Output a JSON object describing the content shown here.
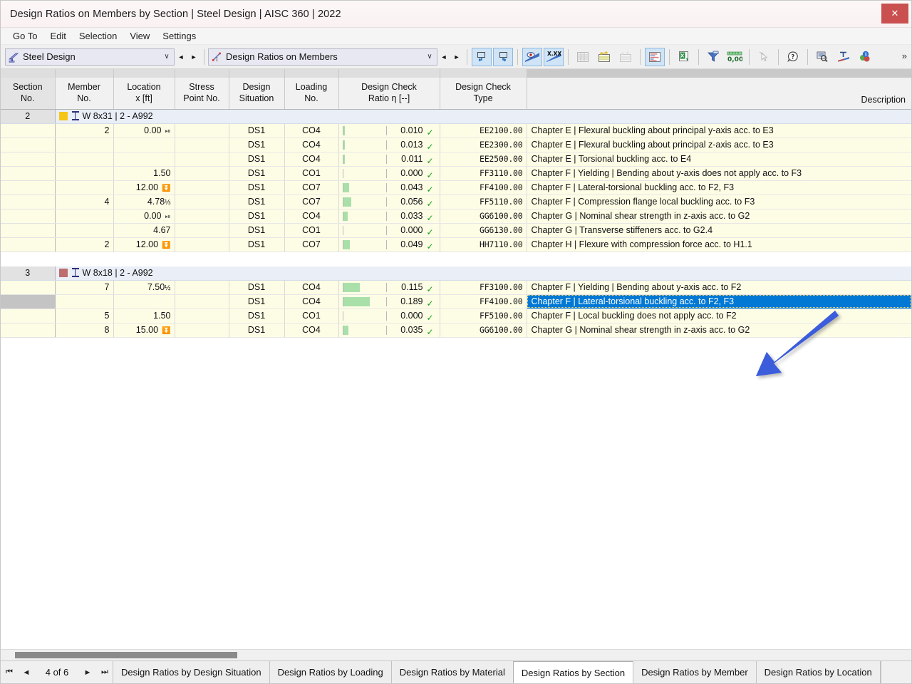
{
  "window": {
    "title": "Design Ratios on Members by Section | Steel Design | AISC 360 | 2022",
    "close_label": "✕"
  },
  "menubar": {
    "items": [
      {
        "label": "Go To"
      },
      {
        "label": "Edit"
      },
      {
        "label": "Selection"
      },
      {
        "label": "View"
      },
      {
        "label": "Settings"
      }
    ]
  },
  "toolbar": {
    "combo_module": {
      "value": "Steel Design",
      "chevron": "∨"
    },
    "combo_table": {
      "value": "Design Ratios on Members",
      "chevron": "∨"
    },
    "nav_prev": "◄",
    "nav_next": "►",
    "overflow": "»",
    "buttons": [
      {
        "name": "select-in-graphic-icon",
        "active": true
      },
      {
        "name": "select-in-table-icon",
        "active": true
      },
      {
        "name": "show-results-icon",
        "active": true
      },
      {
        "name": "show-values-icon",
        "active": true
      },
      {
        "name": "table-grid-icon",
        "active": false
      },
      {
        "name": "table-highlight-icon",
        "active": false
      },
      {
        "name": "table-plain-icon",
        "active": false
      },
      {
        "name": "result-diagram-icon",
        "active": true
      },
      {
        "name": "export-excel-icon",
        "active": false
      },
      {
        "name": "filter-icon",
        "active": false
      },
      {
        "name": "decimal-places-icon",
        "active": false
      },
      {
        "name": "pointer-disabled-icon",
        "active": false
      },
      {
        "name": "help-icon",
        "active": false
      },
      {
        "name": "find-icon",
        "active": false
      },
      {
        "name": "units-icon",
        "active": false
      },
      {
        "name": "info-colors-icon",
        "active": false
      }
    ]
  },
  "table": {
    "columns": [
      {
        "key": "rowhdr",
        "label": ""
      },
      {
        "key": "section_no",
        "label_l1": "Section",
        "label_l2": "No."
      },
      {
        "key": "member_no",
        "label_l1": "Member",
        "label_l2": "No."
      },
      {
        "key": "location",
        "label_l1": "Location",
        "label_l2": "x [ft]"
      },
      {
        "key": "stress_point",
        "label_l1": "Stress",
        "label_l2": "Point No."
      },
      {
        "key": "design_situation",
        "label_l1": "Design",
        "label_l2": "Situation"
      },
      {
        "key": "loading_no",
        "label_l1": "Loading",
        "label_l2": "No."
      },
      {
        "key": "ratio",
        "label_l1": "Design Check",
        "label_l2": "Ratio η [--]"
      },
      {
        "key": "check_type",
        "label_l1": "Design Check",
        "label_l2": "Type"
      },
      {
        "key": "description",
        "label_l1": "",
        "label_l2": "Description"
      }
    ],
    "groups": [
      {
        "section_no": "2",
        "swatch_color": "#f5c518",
        "label": "W 8x31 | 2 - A992",
        "rows": [
          {
            "member_no": "2",
            "location": "0.00",
            "locmark": "start",
            "stress_point": "",
            "design_situation": "DS1",
            "loading_no": "CO4",
            "ratio": "0.010",
            "ratio_value": 0.01,
            "check_type": "EE2100.00",
            "description": "Chapter E | Flexural buckling about principal y-axis acc. to E3",
            "selected": false
          },
          {
            "member_no": "",
            "location": "",
            "locmark": "",
            "stress_point": "",
            "design_situation": "DS1",
            "loading_no": "CO4",
            "ratio": "0.013",
            "ratio_value": 0.013,
            "check_type": "EE2300.00",
            "description": "Chapter E | Flexural buckling about principal z-axis acc. to E3",
            "selected": false
          },
          {
            "member_no": "",
            "location": "",
            "locmark": "",
            "stress_point": "",
            "design_situation": "DS1",
            "loading_no": "CO4",
            "ratio": "0.011",
            "ratio_value": 0.011,
            "check_type": "EE2500.00",
            "description": "Chapter E | Torsional buckling acc. to E4",
            "selected": false
          },
          {
            "member_no": "",
            "location": "1.50",
            "locmark": "",
            "stress_point": "",
            "design_situation": "DS1",
            "loading_no": "CO1",
            "ratio": "0.000",
            "ratio_value": 0.0,
            "check_type": "FF3110.00",
            "description": "Chapter F | Yielding | Bending about y-axis does not apply acc. to F3",
            "selected": false
          },
          {
            "member_no": "",
            "location": "12.00",
            "locmark": "end",
            "stress_point": "",
            "design_situation": "DS1",
            "loading_no": "CO7",
            "ratio": "0.043",
            "ratio_value": 0.043,
            "check_type": "FF4100.00",
            "description": "Chapter F | Lateral-torsional buckling acc. to F2, F3",
            "selected": false
          },
          {
            "member_no": "4",
            "location": "4.78",
            "locfrac": "1/3",
            "locmark": "",
            "stress_point": "",
            "design_situation": "DS1",
            "loading_no": "CO7",
            "ratio": "0.056",
            "ratio_value": 0.056,
            "check_type": "FF5110.00",
            "description": "Chapter F | Compression flange local buckling acc. to F3",
            "selected": false
          },
          {
            "member_no": "",
            "location": "0.00",
            "locmark": "start",
            "stress_point": "",
            "design_situation": "DS1",
            "loading_no": "CO4",
            "ratio": "0.033",
            "ratio_value": 0.033,
            "check_type": "GG6100.00",
            "description": "Chapter G | Nominal shear strength in z-axis acc. to G2",
            "selected": false
          },
          {
            "member_no": "",
            "location": "4.67",
            "locmark": "",
            "stress_point": "",
            "design_situation": "DS1",
            "loading_no": "CO1",
            "ratio": "0.000",
            "ratio_value": 0.0,
            "check_type": "GG6130.00",
            "description": "Chapter G | Transverse stiffeners acc. to G2.4",
            "selected": false
          },
          {
            "member_no": "2",
            "location": "12.00",
            "locmark": "end",
            "stress_point": "",
            "design_situation": "DS1",
            "loading_no": "CO7",
            "ratio": "0.049",
            "ratio_value": 0.049,
            "check_type": "HH7110.00",
            "description": "Chapter H | Flexure with compression force acc. to H1.1",
            "selected": false
          }
        ]
      },
      {
        "section_no": "3",
        "swatch_color": "#bd6d6d",
        "label": "W 8x18 | 2 - A992",
        "rows": [
          {
            "member_no": "7",
            "location": "7.50",
            "locfrac": "1/2",
            "locmark": "",
            "stress_point": "",
            "design_situation": "DS1",
            "loading_no": "CO4",
            "ratio": "0.115",
            "ratio_value": 0.115,
            "check_type": "FF3100.00",
            "description": "Chapter F | Yielding | Bending about y-axis acc. to F2",
            "selected": false
          },
          {
            "member_no": "",
            "location": "",
            "locmark": "",
            "stress_point": "",
            "design_situation": "DS1",
            "loading_no": "CO4",
            "ratio": "0.189",
            "ratio_value": 0.189,
            "check_type": "FF4100.00",
            "description": "Chapter F | Lateral-torsional buckling acc. to F2, F3",
            "selected": true
          },
          {
            "member_no": "5",
            "location": "1.50",
            "locmark": "",
            "stress_point": "",
            "design_situation": "DS1",
            "loading_no": "CO1",
            "ratio": "0.000",
            "ratio_value": 0.0,
            "check_type": "FF5100.00",
            "description": "Chapter F | Local buckling does not apply acc. to F2",
            "selected": false
          },
          {
            "member_no": "8",
            "location": "15.00",
            "locmark": "end",
            "stress_point": "",
            "design_situation": "DS1",
            "loading_no": "CO4",
            "ratio": "0.035",
            "ratio_value": 0.035,
            "check_type": "GG6100.00",
            "description": "Chapter G | Nominal shear strength in z-axis acc. to G2",
            "selected": false
          }
        ]
      }
    ]
  },
  "annotation": {
    "name": "blue-arrow-pointing-to-selected-row",
    "color": "#3b5bdb"
  },
  "statusbar": {
    "first": "⏮",
    "prev": "◄",
    "page_text": "4 of 6",
    "next": "►",
    "last": "⏭",
    "tabs": [
      {
        "label": "Design Ratios by Design Situation",
        "active": false
      },
      {
        "label": "Design Ratios by Loading",
        "active": false
      },
      {
        "label": "Design Ratios by Material",
        "active": false
      },
      {
        "label": "Design Ratios by Section",
        "active": true
      },
      {
        "label": "Design Ratios by Member",
        "active": false
      },
      {
        "label": "Design Ratios by Location",
        "active": false
      }
    ]
  },
  "colors": {
    "selection_blue": "#0078d4",
    "group_row": "#e9eef7",
    "alt_row": "#fdfde6",
    "ratio_fill": "#a9e0a9",
    "check_green": "#16a016",
    "close_red": "#c9504f"
  }
}
